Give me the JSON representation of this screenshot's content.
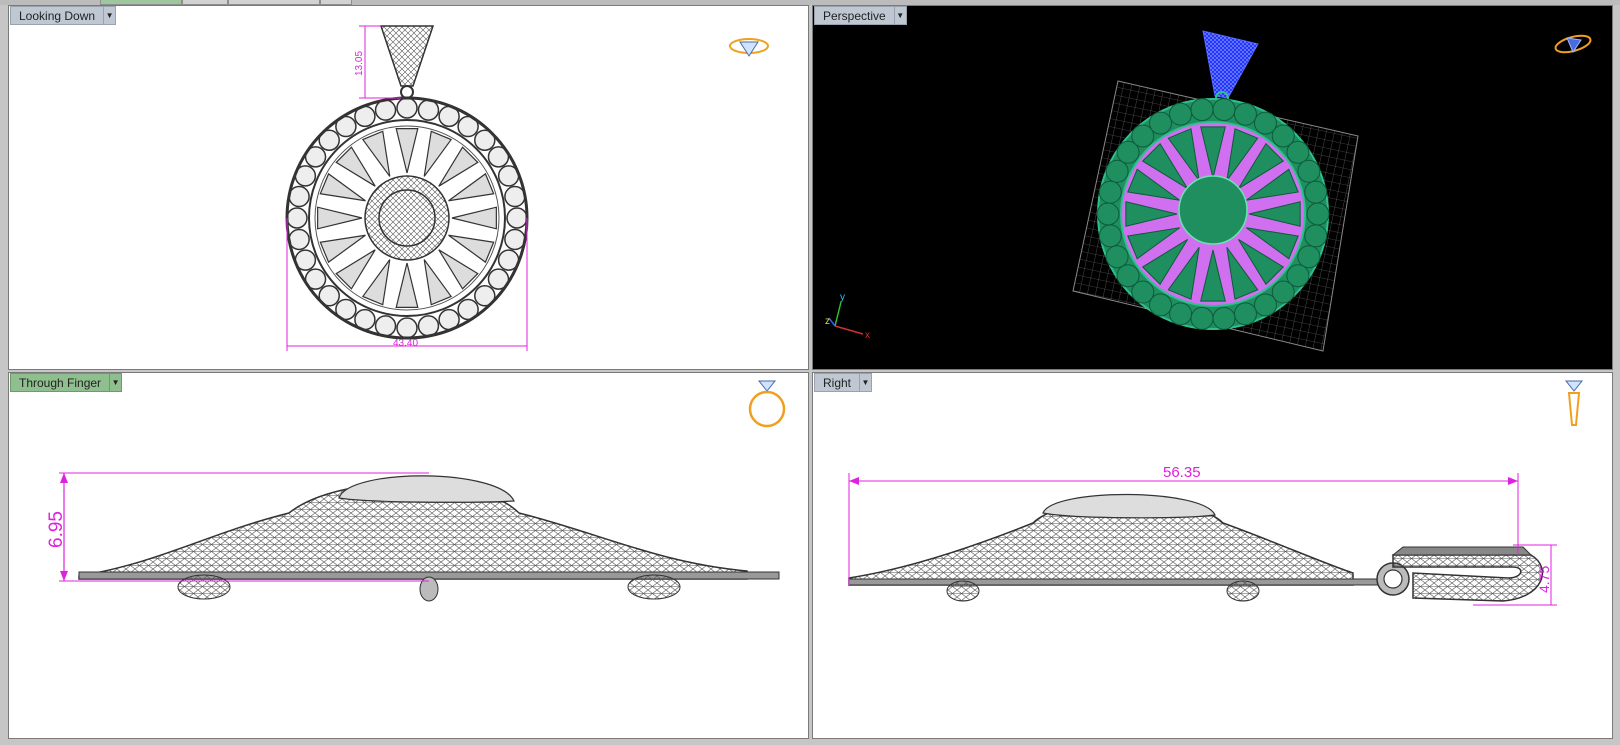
{
  "viewports": {
    "top_left": {
      "name": "Looking Down",
      "dim_width": "43.40",
      "dim_height": "13.05"
    },
    "top_right": {
      "name": "Perspective",
      "axis_x": "x",
      "axis_y": "y",
      "axis_z": "z"
    },
    "bottom_left": {
      "name": "Through Finger",
      "dim_height": "6.95"
    },
    "bottom_right": {
      "name": "Right",
      "dim_width": "56.35",
      "dim_height": "4.75"
    }
  },
  "colors": {
    "background_white": "#ffffff",
    "background_black": "#000000",
    "dimension": "#e020e0",
    "active_label": "#8fbf8f",
    "label": "#bfc8d2",
    "gem_green": "#1f8f5f",
    "highlight_blue": "#1a2cff",
    "magenta_fill": "#d070f0",
    "ring_icon": "#f0a020"
  },
  "icons": [
    "pendant-orientation-icon",
    "ring-orientation-icon",
    "dropdown-arrow-icon",
    "axis-gizmo-icon"
  ]
}
